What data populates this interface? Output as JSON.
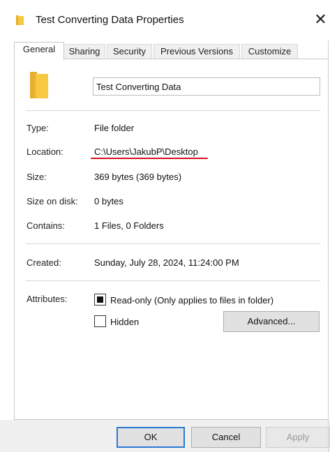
{
  "window": {
    "title": "Test Converting Data Properties",
    "close_glyph": "✕"
  },
  "tabs": [
    {
      "label": "General",
      "active": true
    },
    {
      "label": "Sharing",
      "active": false
    },
    {
      "label": "Security",
      "active": false
    },
    {
      "label": "Previous Versions",
      "active": false
    },
    {
      "label": "Customize",
      "active": false
    }
  ],
  "general": {
    "name": "Test Converting Data",
    "type_label": "Type:",
    "type_value": "File folder",
    "location_label": "Location:",
    "location_value": "C:\\Users\\JakubP\\Desktop",
    "size_label": "Size:",
    "size_value": "369 bytes (369 bytes)",
    "size_on_disk_label": "Size on disk:",
    "size_on_disk_value": "0 bytes",
    "contains_label": "Contains:",
    "contains_value": "1 Files, 0 Folders",
    "created_label": "Created:",
    "created_value": "Sunday, July 28, 2024, 11:24:00 PM",
    "attributes_label": "Attributes:",
    "readonly_label": "Read-only (Only applies to files in folder)",
    "readonly_state": "indeterminate",
    "hidden_label": "Hidden",
    "hidden_checked": false,
    "advanced_label": "Advanced..."
  },
  "footer": {
    "ok_label": "OK",
    "cancel_label": "Cancel",
    "apply_label": "Apply"
  },
  "colors": {
    "folder": "#f8c843",
    "annotation_underline": "#d40f1a",
    "default_button_border": "#2a78d4"
  },
  "icons": {
    "title": "folder-icon",
    "large": "folder-icon",
    "close": "close-icon"
  }
}
